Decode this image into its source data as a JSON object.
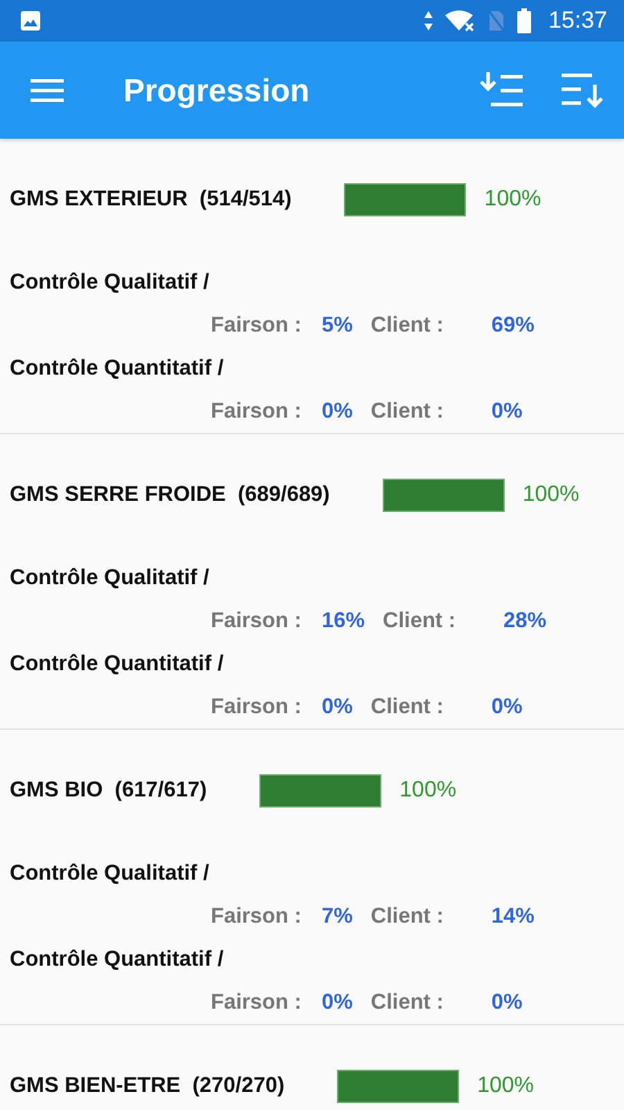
{
  "status_bar": {
    "time": "15:37"
  },
  "app_bar": {
    "title": "Progression"
  },
  "groups": [
    {
      "name": "GMS EXTERIEUR  (514/514)",
      "level": 1,
      "percent": "100%",
      "controls": [
        {
          "label": "Contrôle Qualitatif /",
          "fairson_label": "Fairson :",
          "fairson": "5%",
          "client_label": "Client :",
          "client": "69%"
        },
        {
          "label": "Contrôle Quantitatif /",
          "fairson_label": "Fairson :",
          "fairson": "0%",
          "client_label": "Client :",
          "client": "0%"
        }
      ]
    },
    {
      "name": "GMS SERRE FROIDE  (689/689)",
      "level": 1,
      "percent": "100%",
      "controls": [
        {
          "label": "Contrôle Qualitatif /",
          "fairson_label": "Fairson :",
          "fairson": "16%",
          "client_label": "Client :",
          "client": "28%"
        },
        {
          "label": "Contrôle Quantitatif /",
          "fairson_label": "Fairson :",
          "fairson": "0%",
          "client_label": "Client :",
          "client": "0%"
        }
      ]
    },
    {
      "name": "GMS BIO  (617/617)",
      "level": 1,
      "percent": "100%",
      "controls": [
        {
          "label": "Contrôle Qualitatif /",
          "fairson_label": "Fairson :",
          "fairson": "7%",
          "client_label": "Client :",
          "client": "14%"
        },
        {
          "label": "Contrôle Quantitatif /",
          "fairson_label": "Fairson :",
          "fairson": "0%",
          "client_label": "Client :",
          "client": "0%"
        }
      ]
    },
    {
      "name": "GMS BIEN-ETRE  (270/270)",
      "level": 1,
      "percent": "100%"
    }
  ]
}
